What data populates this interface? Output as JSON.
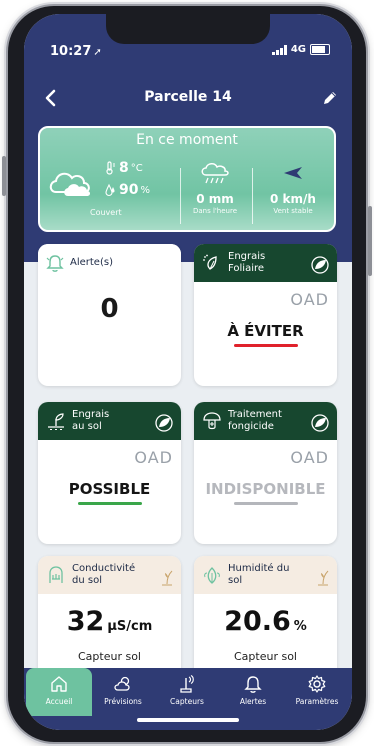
{
  "status_bar": {
    "time": "10:27",
    "network": "4G"
  },
  "header": {
    "title": "Parcelle 14"
  },
  "weather": {
    "title": "En ce moment",
    "temperature": "8",
    "temperature_unit": "°C",
    "humidity": "90",
    "humidity_unit": "%",
    "sky_label": "Couvert",
    "rain_value": "0 mm",
    "rain_label": "Dans l'heure",
    "wind_value": "0 km/h",
    "wind_label": "Vent stable"
  },
  "cards": {
    "alerts": {
      "label": "Alerte(s)",
      "value": "0"
    },
    "foliar": {
      "label_line1": "Engrais",
      "label_line2": "Foliaire",
      "badge": "OAD",
      "status": "À ÉVITER",
      "status_color": "#e0212b"
    },
    "soil_fert": {
      "label_line1": "Engrais",
      "label_line2": "au sol",
      "badge": "OAD",
      "status": "POSSIBLE",
      "status_color": "#3aa64a"
    },
    "fungicide": {
      "label_line1": "Traitement",
      "label_line2": "fongicide",
      "badge": "OAD",
      "status": "INDISPONIBLE",
      "status_color": "#b4b6bb"
    },
    "conductivity": {
      "label_line1": "Conductivité",
      "label_line2": "du sol",
      "value": "32",
      "unit": "µS/cm",
      "source": "Capteur sol"
    },
    "soil_humidity": {
      "label_line1": "Humidité du",
      "label_line2": "sol",
      "value": "20.6",
      "unit": "%",
      "source": "Capteur sol"
    }
  },
  "tabs": [
    {
      "label": "Accueil",
      "icon": "home-icon"
    },
    {
      "label": "Prévisions",
      "icon": "cloud-sun-icon"
    },
    {
      "label": "Capteurs",
      "icon": "sensor-icon"
    },
    {
      "label": "Alertes",
      "icon": "bell-icon"
    },
    {
      "label": "Paramètres",
      "icon": "gear-icon"
    }
  ],
  "colors": {
    "primary": "#2f3b74",
    "accent": "#6ec2a0",
    "dark_green": "#17472f"
  }
}
